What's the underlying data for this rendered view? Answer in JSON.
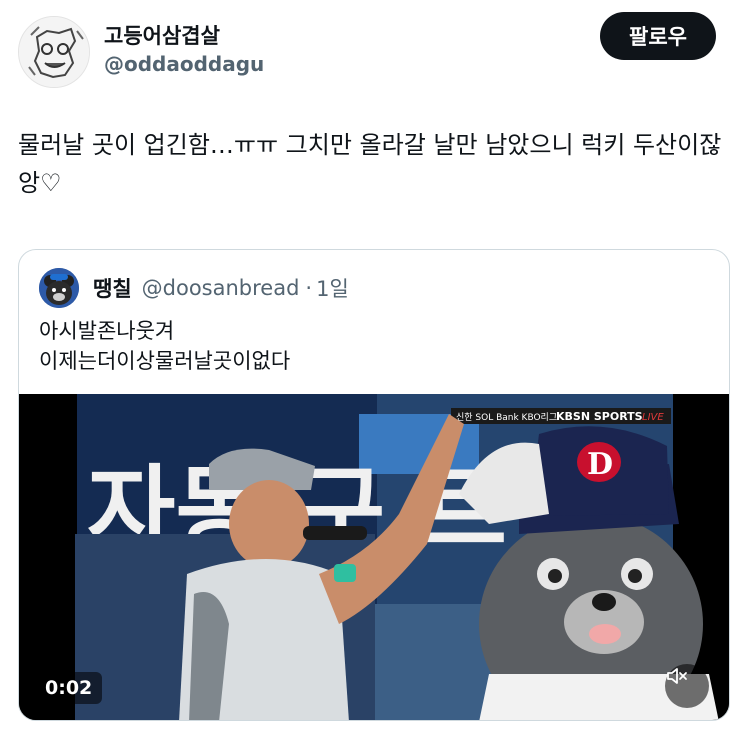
{
  "author": {
    "display_name": "고등어삼겹살",
    "handle": "@oddaoddagu",
    "avatar_icon": "doodle-avatar-icon"
  },
  "follow_button": {
    "label": "팔로우"
  },
  "tweet": {
    "text": "물러날 곳이 업긴함…ㅠㅠ 그치만 올라갈 날만 남았으니 럭키 두산이잖앙♡"
  },
  "quoted_tweet": {
    "display_name": "땡칠",
    "handle": "@doosanbread",
    "separator": "·",
    "time": "1일",
    "text_line1": "아시발존나웃겨",
    "text_line2": "이제는더이상물러날곳이없다",
    "avatar_icon": "bear-mascot-avatar-icon"
  },
  "video": {
    "duration": "0:02",
    "scoreboard_text": "자동 구 르",
    "broadcast_logo": "KBSN SPORTS",
    "live_label": "LIVE",
    "sponsor_text": "신한 SOL Bank KBO리그",
    "mascot_cap_letter": "D",
    "mute_icon": "speaker-muted-icon",
    "colors": {
      "background": "#000000",
      "stadium_blue": "#1f3f7a",
      "cap_navy": "#1b2550",
      "cap_red": "#c8102e"
    }
  }
}
